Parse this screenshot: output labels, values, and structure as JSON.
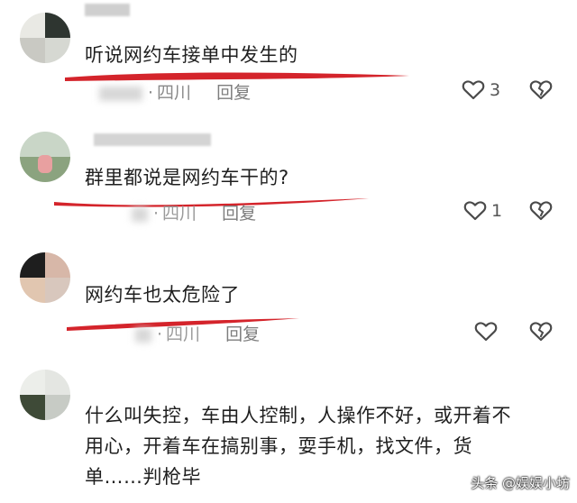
{
  "comments": [
    {
      "text": "听说网约车接单中发生的",
      "location": "四川",
      "reply_label": "回复",
      "like_count": "3"
    },
    {
      "text": "群里都说是网约车干的?",
      "location": "四川",
      "reply_label": "回复",
      "like_count": "1"
    },
    {
      "text": "网约车也太危险了",
      "location": "四川",
      "reply_label": "回复",
      "like_count": ""
    },
    {
      "text_lines": [
        "什么叫失控，车由人控制，人操作不好，或开着不",
        "用心，开着车在搞别事，耍手机，找文件，货",
        "单……判枪毕"
      ]
    }
  ],
  "watermark": "头条 @娱娱小坊",
  "colors": {
    "underline": "#d4242b",
    "text": "#1f1f1f",
    "meta": "#8a8a8a"
  },
  "icons": [
    "heart-outline-icon",
    "broken-heart-icon"
  ]
}
